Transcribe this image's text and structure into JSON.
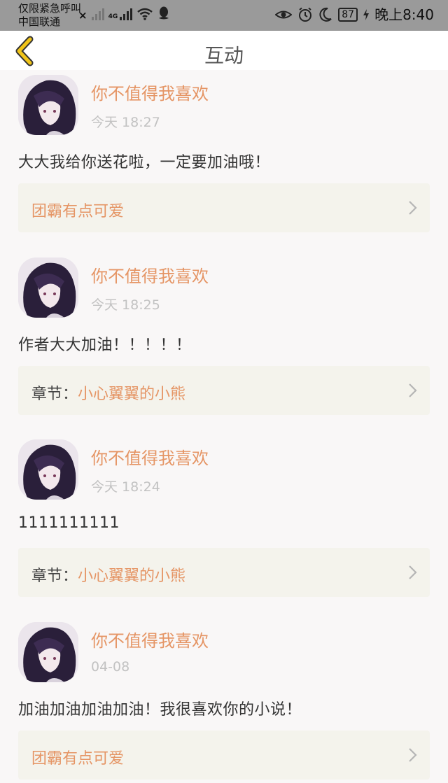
{
  "status_bar": {
    "carrier_line1": "仅限紧急呼叫",
    "carrier_line2": "中国联通",
    "network_tag": "4G",
    "battery": "87",
    "time": "晚上8:40"
  },
  "header": {
    "title": "互动"
  },
  "posts": [
    {
      "username": "你不值得我喜欢",
      "time": "今天 18:27",
      "text": "大大我给你送花啦，一定要加油哦！",
      "card_prefix": "",
      "card_title": "团霸有点可爱"
    },
    {
      "username": "你不值得我喜欢",
      "time": "今天 18:25",
      "text": "作者大大加油！！！！！",
      "card_prefix": "章节：",
      "card_title": "小心翼翼的小熊"
    },
    {
      "username": "你不值得我喜欢",
      "time": "今天 18:24",
      "text": "1111111111",
      "card_prefix": "章节：",
      "card_title": "小心翼翼的小熊"
    },
    {
      "username": "你不值得我喜欢",
      "time": "04-08",
      "text": "加油加油加油加油！我很喜欢你的小说！",
      "card_prefix": "",
      "card_title": "团霸有点可爱"
    }
  ],
  "colors": {
    "accent": "#e59565",
    "back_arrow": "#f0c419",
    "card_bg": "#f4f3ec",
    "page_bg": "#f9f7f7"
  }
}
